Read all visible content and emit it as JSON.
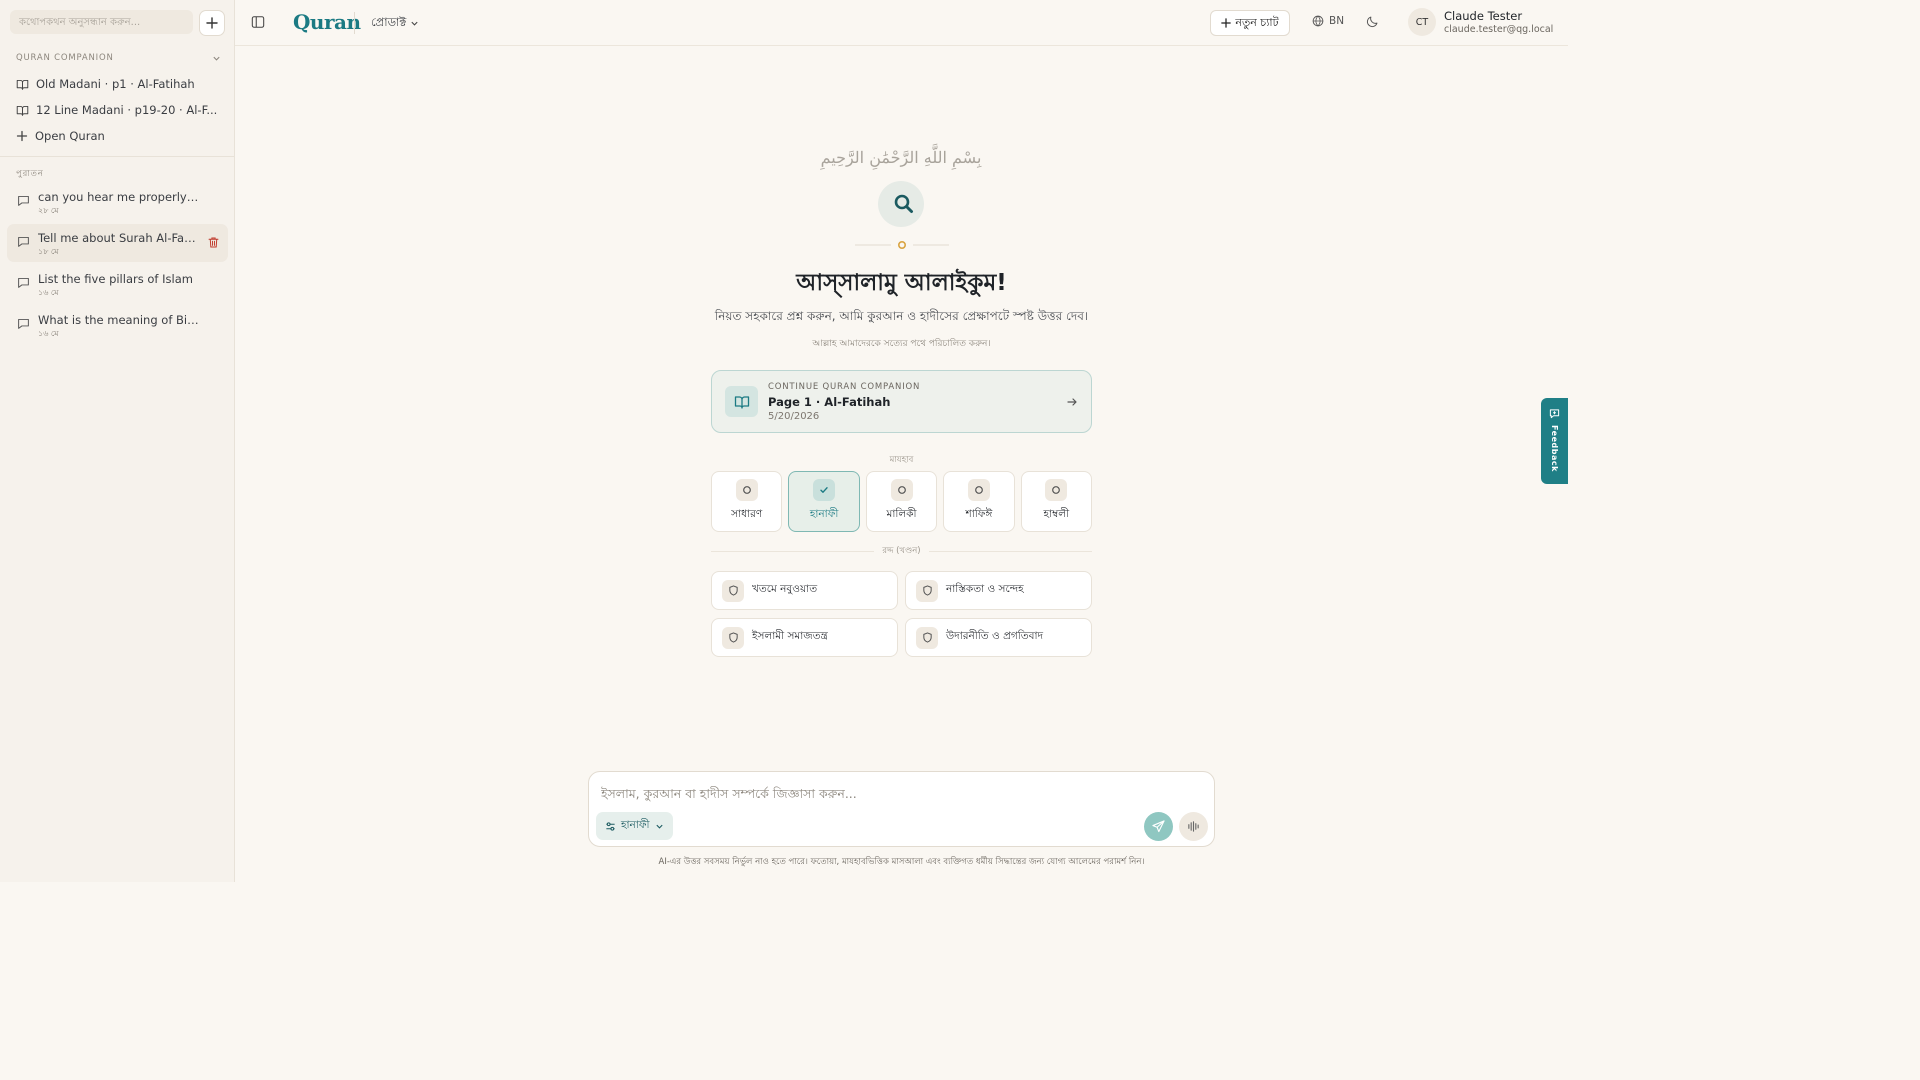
{
  "sidebar": {
    "search_placeholder": "কথোপকথন অনুসন্ধান করুন...",
    "section_title": "QURAN COMPANION",
    "companion_items": [
      {
        "label": "Old Madani · p1 · Al-Fatihah"
      },
      {
        "label": "12 Line Madani · p19-20 · Al-F..."
      },
      {
        "label": "Open Quran"
      }
    ],
    "history_title": "পুরাতন",
    "chats": [
      {
        "title": "can you hear me properly or I...",
        "date": "২৮ মে"
      },
      {
        "title": "Tell me about Surah Al-Fatihah",
        "date": "১৮ মে"
      },
      {
        "title": "List the five pillars of Islam",
        "date": "১৬ মে"
      },
      {
        "title": "What is the meaning of Bismil...",
        "date": "১৬ মে"
      }
    ]
  },
  "header": {
    "logo_text": "Quran",
    "product_label": "প্রোডাক্ট",
    "new_chat_label": "নতুন চ্যাট",
    "language": "BN",
    "user": {
      "initials": "CT",
      "name": "Claude Tester",
      "email": "claude.tester@qg.local"
    }
  },
  "main": {
    "bismillah": "بِسْمِ اللَّهِ الرَّحْمَٰنِ الرَّحِيمِ",
    "greeting": "আস্সালামু আলাইকুম!",
    "subtitle": "নিয়ত সহকারে প্রশ্ন করুন, আমি কুরআন ও হাদীসের প্রেক্ষাপটে স্পষ্ট উত্তর দেব।",
    "blessing": "আল্লাহ আমাদেরকে সত্যের পথে পরিচালিত করুন।",
    "continue_card": {
      "label": "CONTINUE QURAN COMPANION",
      "title": "Page 1 · Al-Fatihah",
      "date": "5/20/2026"
    },
    "madhab_label": "মাযহাব",
    "madhabs": [
      {
        "label": "সাধারণ",
        "selected": false
      },
      {
        "label": "হানাফী",
        "selected": true
      },
      {
        "label": "মালিকী",
        "selected": false
      },
      {
        "label": "শাফিঈ",
        "selected": false
      },
      {
        "label": "হাম্বলী",
        "selected": false
      }
    ],
    "radd_label": "রদ্দ (খণ্ডন)",
    "topics": [
      {
        "label": "খতমে নবুওয়াত"
      },
      {
        "label": "নাস্তিকতা ও সন্দেহ"
      },
      {
        "label": "ইসলামী সমাজতন্ত্র"
      },
      {
        "label": "উদারনীতি ও প্রগতিবাদ"
      }
    ]
  },
  "composer": {
    "placeholder": "ইসলাম, কুরআন বা হাদীস সম্পর্কে জিজ্ঞাসা করুন...",
    "madhab_chip": "হানাফী",
    "disclaimer": "AI-এর উত্তর সবসময় নির্ভুল নাও হতে পারে। ফতোয়া, মাযহাবভিত্তিক মাসআলা এবং ব্যক্তিগত ধর্মীয় সিদ্ধান্তের জন্য যোগ্য আলেমের পরামর্শ নিন।"
  },
  "feedback_label": "Feedback",
  "colors": {
    "accent": "#1b7a83",
    "background": "#faf7f2",
    "sidebar": "#f6f2ec",
    "danger": "#c0392b",
    "gold": "#d9a441"
  }
}
